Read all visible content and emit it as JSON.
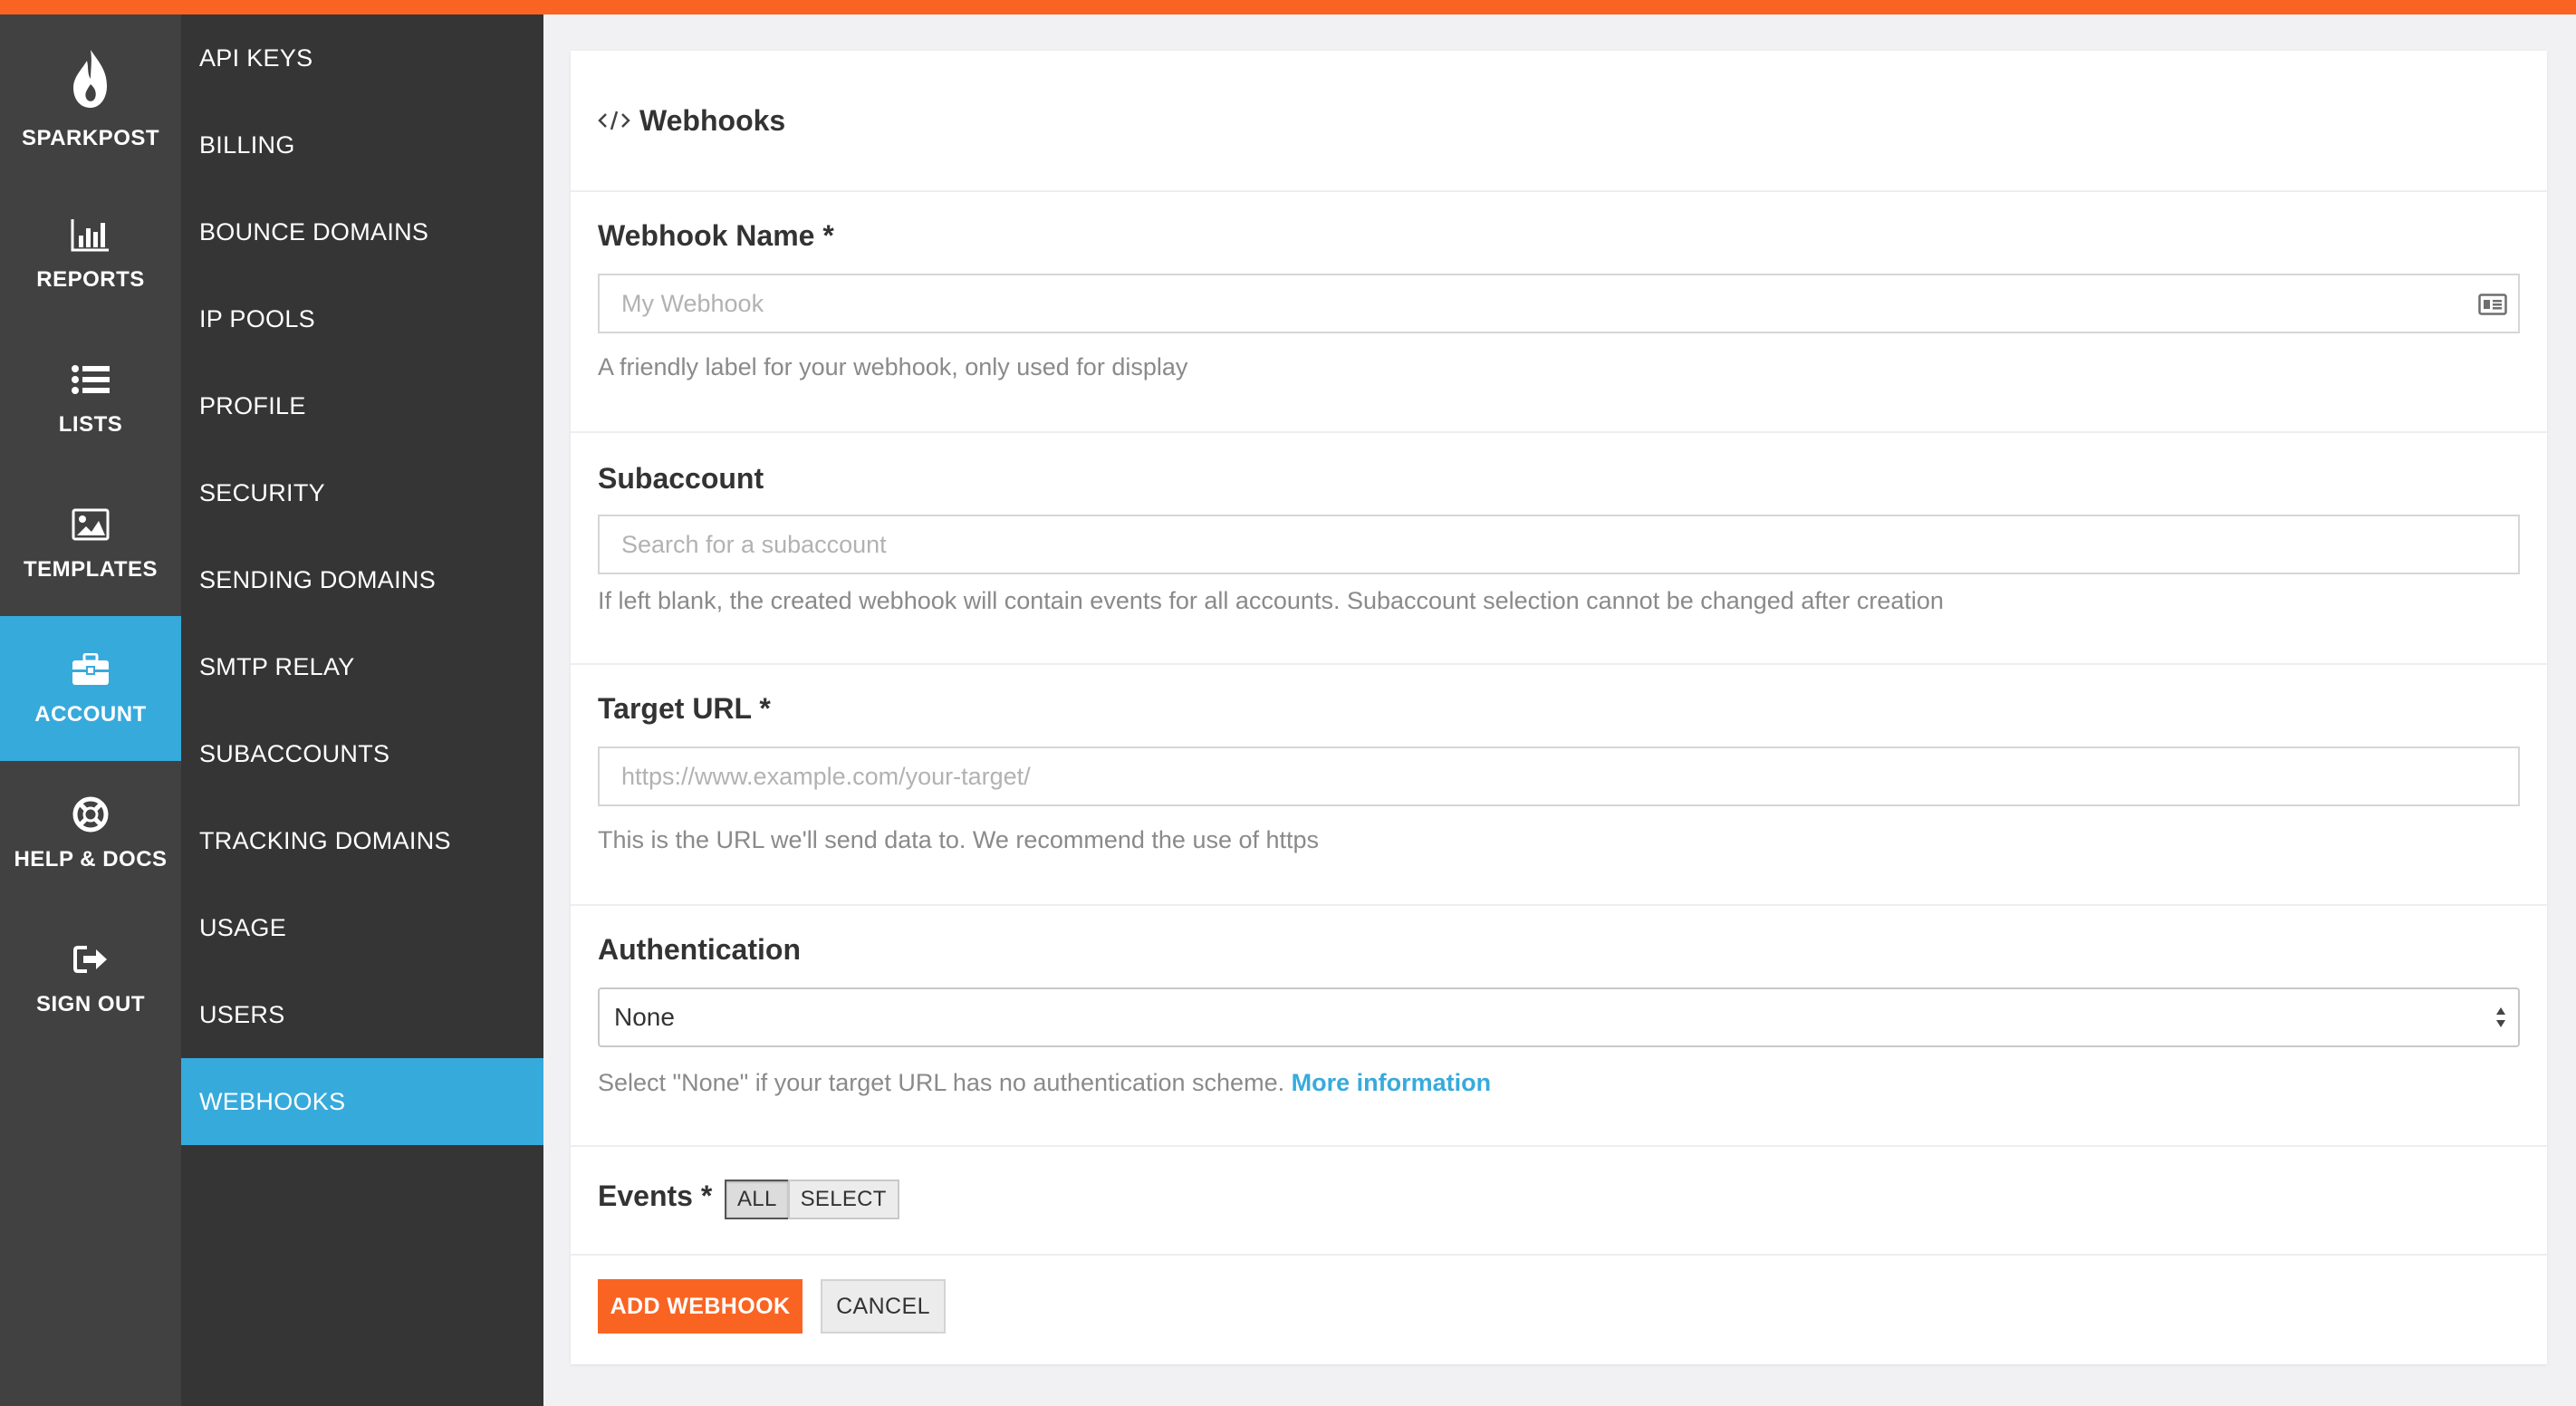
{
  "colors": {
    "brand_orange": "#fa6423",
    "accent_blue": "#37aadc",
    "nav_dark": "#414141",
    "subnav_dark": "#353535"
  },
  "primary_nav": {
    "brand": {
      "label": "SPARKPOST",
      "icon": "flame-icon"
    },
    "items": [
      {
        "label": "REPORTS",
        "icon": "bar-chart-icon",
        "active": false
      },
      {
        "label": "LISTS",
        "icon": "list-icon",
        "active": false
      },
      {
        "label": "TEMPLATES",
        "icon": "image-icon",
        "active": false
      },
      {
        "label": "ACCOUNT",
        "icon": "briefcase-icon",
        "active": true
      },
      {
        "label": "HELP & DOCS",
        "icon": "lifebuoy-icon",
        "active": false
      },
      {
        "label": "SIGN OUT",
        "icon": "sign-out-icon",
        "active": false
      }
    ]
  },
  "secondary_nav": {
    "items": [
      {
        "label": "API KEYS",
        "active": false
      },
      {
        "label": "BILLING",
        "active": false
      },
      {
        "label": "BOUNCE DOMAINS",
        "active": false
      },
      {
        "label": "IP POOLS",
        "active": false
      },
      {
        "label": "PROFILE",
        "active": false
      },
      {
        "label": "SECURITY",
        "active": false
      },
      {
        "label": "SENDING DOMAINS",
        "active": false
      },
      {
        "label": "SMTP RELAY",
        "active": false
      },
      {
        "label": "SUBACCOUNTS",
        "active": false
      },
      {
        "label": "TRACKING DOMAINS",
        "active": false
      },
      {
        "label": "USAGE",
        "active": false
      },
      {
        "label": "USERS",
        "active": false
      },
      {
        "label": "WEBHOOKS",
        "active": true
      }
    ]
  },
  "panel": {
    "title": "Webhooks",
    "title_icon": "code-icon"
  },
  "form": {
    "webhook_name": {
      "label": "Webhook Name *",
      "placeholder": "My Webhook",
      "value": "",
      "help": "A friendly label for your webhook, only used for display",
      "icon": "contact-card-icon"
    },
    "subaccount": {
      "label": "Subaccount",
      "placeholder": "Search for a subaccount",
      "value": "",
      "help": "If left blank, the created webhook will contain events for all accounts. Subaccount selection cannot be changed after creation"
    },
    "target_url": {
      "label": "Target URL *",
      "placeholder": "https://www.example.com/your-target/",
      "value": "",
      "help": "This is the URL we'll send data to. We recommend the use of https"
    },
    "authentication": {
      "label": "Authentication",
      "selected": "None",
      "help": "Select \"None\" if your target URL has no authentication scheme.",
      "help_link": "More information"
    },
    "events": {
      "label": "Events *",
      "options": [
        "ALL",
        "SELECT"
      ],
      "selected": "ALL"
    },
    "actions": {
      "submit_label": "ADD WEBHOOK",
      "cancel_label": "CANCEL"
    }
  }
}
